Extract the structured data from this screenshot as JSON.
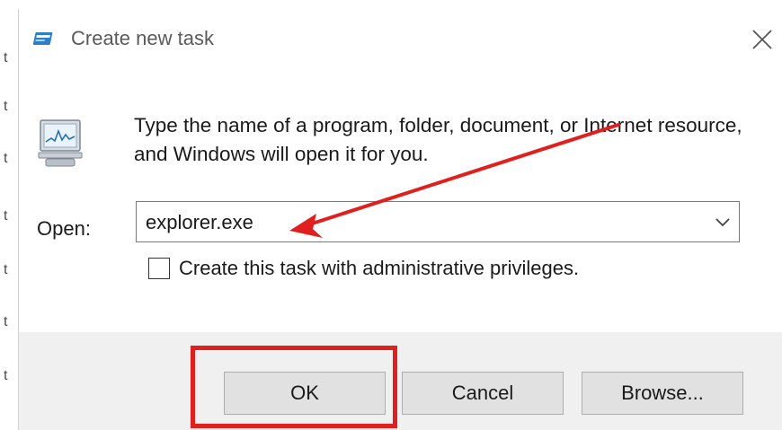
{
  "window": {
    "title": "Create new task",
    "title_icon": "run-dialog-icon",
    "close_icon": "close-icon"
  },
  "main": {
    "program_icon": "run-program-icon",
    "description": "Type the name of a program, folder, document, or Internet resource, and Windows will open it for you.",
    "open_label": "Open:",
    "open_value": "explorer.exe",
    "dropdown_icon": "chevron-down-icon",
    "admin_checkbox": {
      "label": "Create this task with administrative privileges.",
      "checked": false
    }
  },
  "buttons": {
    "ok": "OK",
    "cancel": "Cancel",
    "browse": "Browse..."
  },
  "annotations": {
    "arrow_color": "#e0201f",
    "highlight_color": "#e0201f"
  },
  "background": {
    "glyph": "t"
  }
}
